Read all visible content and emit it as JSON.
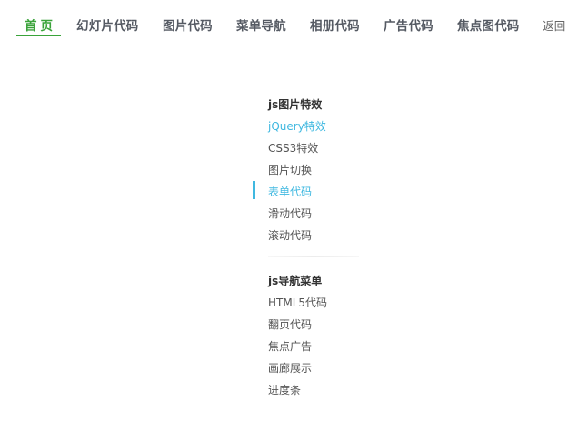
{
  "nav": {
    "items": [
      {
        "label": "首页"
      },
      {
        "label": "幻灯片代码"
      },
      {
        "label": "图片代码"
      },
      {
        "label": "菜单导航"
      },
      {
        "label": "相册代码"
      },
      {
        "label": "广告代码"
      },
      {
        "label": "焦点图代码"
      }
    ],
    "back_label": "返回",
    "active_color": "#3aa33a"
  },
  "menu": {
    "groups": [
      {
        "title": "js图片特效",
        "items": [
          {
            "label": "jQuery特效"
          },
          {
            "label": "CSS3特效"
          },
          {
            "label": "图片切换"
          },
          {
            "label": "表单代码"
          },
          {
            "label": "滑动代码"
          },
          {
            "label": "滚动代码"
          }
        ]
      },
      {
        "title": "js导航菜单",
        "items": [
          {
            "label": "HTML5代码"
          },
          {
            "label": "翻页代码"
          },
          {
            "label": "焦点广告"
          },
          {
            "label": "画廊展示"
          },
          {
            "label": "进度条"
          }
        ]
      }
    ],
    "highlight_color": "#3fb8e0"
  }
}
